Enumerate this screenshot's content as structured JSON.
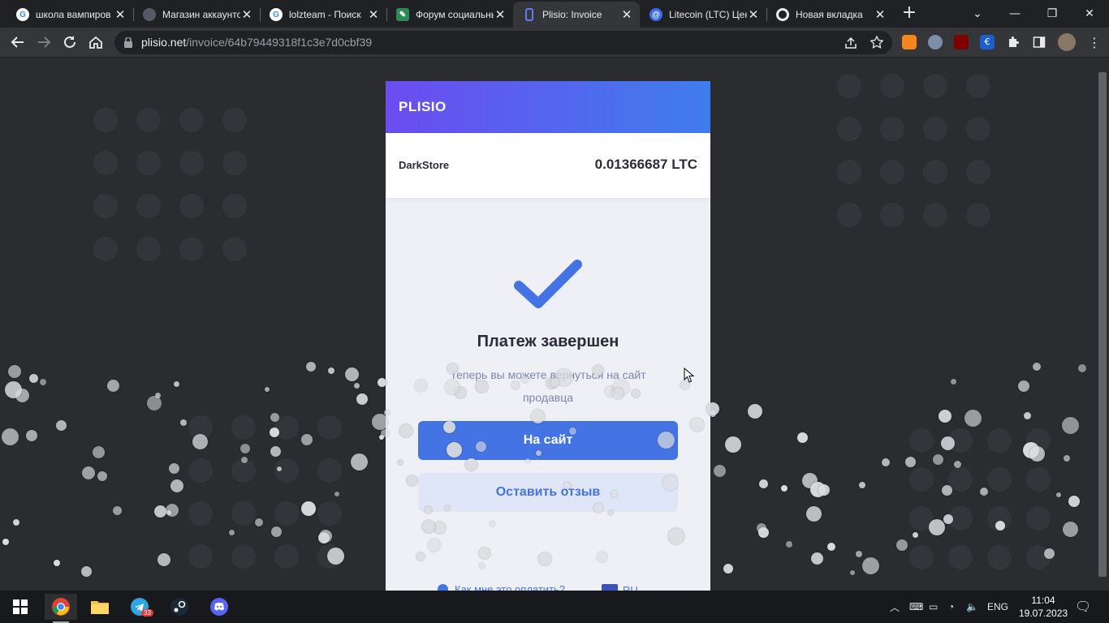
{
  "tabs": [
    {
      "title": "школа вампиров",
      "favicon": "google-icon",
      "favicon_color": "#4285f4"
    },
    {
      "title": "Магазин аккаунтов",
      "favicon": "dark-avatar-icon",
      "favicon_color": "#555a66"
    },
    {
      "title": "lolzteam - Поиск",
      "favicon": "google-icon",
      "favicon_color": "#4285f4"
    },
    {
      "title": "Форум социальных",
      "favicon": "forum-icon",
      "favicon_color": "#2e8b57"
    },
    {
      "title": "Plisio: Invoice",
      "favicon": "plisio-icon",
      "favicon_color": "#5f7cf0",
      "active": true
    },
    {
      "title": "Litecoin (LTC) Цена",
      "favicon": "litecoin-icon",
      "favicon_color": "#3a6df0"
    },
    {
      "title": "Новая вкладка",
      "favicon": "chrome-icon",
      "favicon_color": "#e8eaed"
    }
  ],
  "address_bar": {
    "host": "plisio.net",
    "path": "/invoice/64b79449318f1c3e7d0cbf39"
  },
  "invoice": {
    "brand": "PLISIO",
    "merchant": "DarkStore",
    "amount": "0.01366687 LTC",
    "status_title": "Платеж завершен",
    "status_text": "Теперь вы можете вернуться на сайт продавца",
    "site_button": "На сайт",
    "review_button": "Оставить отзыв",
    "help_link": "Как мне это оплатить?",
    "language": "RU"
  },
  "taskbar": {
    "apps": [
      "windows-start",
      "chrome",
      "file-explorer",
      "telegram",
      "steam",
      "discord"
    ],
    "telegram_badge": "33",
    "language_indicator": "ENG",
    "time": "11:04",
    "date": "19.07.2023"
  },
  "colors": {
    "accent": "#4474e3",
    "header_gradient_start": "#6b4cf0",
    "header_gradient_end": "#3f7ded",
    "page_bg": "#2b2c30"
  }
}
